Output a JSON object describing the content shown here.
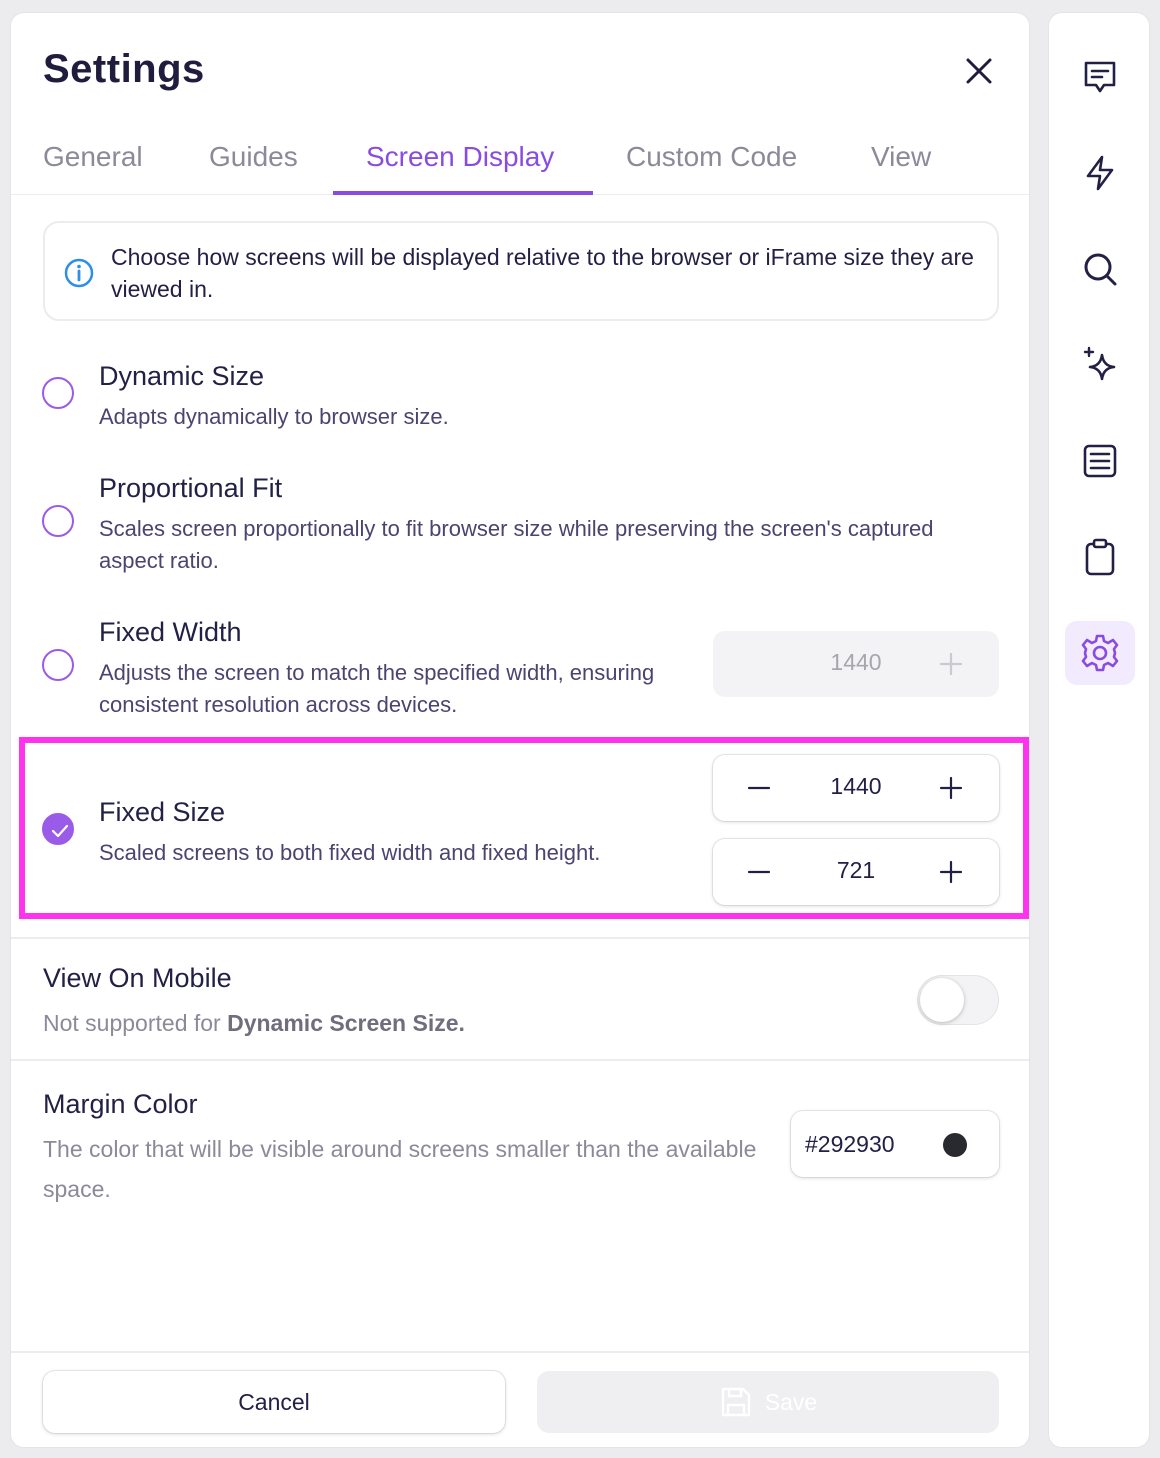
{
  "header": {
    "title": "Settings"
  },
  "tabs": [
    {
      "label": "General",
      "active": false
    },
    {
      "label": "Guides",
      "active": false
    },
    {
      "label": "Screen Display",
      "active": true
    },
    {
      "label": "Custom Code",
      "active": false
    },
    {
      "label": "View",
      "active": false
    }
  ],
  "info": {
    "text": "Choose how screens will be displayed relative to the browser or iFrame size they are viewed in."
  },
  "options": [
    {
      "title": "Dynamic Size",
      "description": "Adapts dynamically to browser size.",
      "selected": false
    },
    {
      "title": "Proportional Fit",
      "description": "Scales screen proportionally to fit browser size while preserving the screen's captured aspect ratio.",
      "selected": false
    },
    {
      "title": "Fixed Width",
      "description": "Adjusts the screen to match the specified width, ensuring consistent resolution across devices.",
      "selected": false,
      "width_value": "1440"
    },
    {
      "title": "Fixed Size",
      "description": "Scaled screens to both fixed width and fixed height.",
      "selected": true,
      "width_value": "1440",
      "height_value": "721"
    }
  ],
  "mobile": {
    "title": "View On Mobile",
    "note_prefix": "Not supported for ",
    "note_bold": "Dynamic Screen Size.",
    "enabled": false
  },
  "margin": {
    "title": "Margin Color",
    "description": "The color that will be visible around screens smaller than the available space.",
    "value": "#292930",
    "swatch_color": "#292930"
  },
  "footer": {
    "cancel_label": "Cancel",
    "save_label": "Save"
  },
  "rail": {
    "items": [
      {
        "icon": "comment-icon",
        "active": false
      },
      {
        "icon": "lightning-icon",
        "active": false
      },
      {
        "icon": "search-icon",
        "active": false
      },
      {
        "icon": "sparkle-icon",
        "active": false
      },
      {
        "icon": "document-icon",
        "active": false
      },
      {
        "icon": "clipboard-icon",
        "active": false
      },
      {
        "icon": "gear-icon",
        "active": true
      }
    ]
  },
  "colors": {
    "accent": "#8a4ce0",
    "radio": "#9a5be8",
    "highlight": "#ff33ee"
  }
}
